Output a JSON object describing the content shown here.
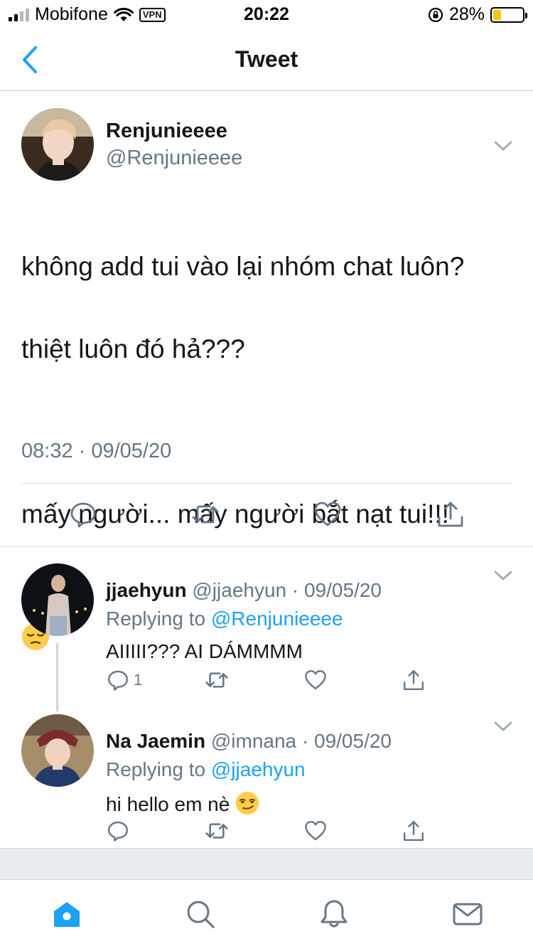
{
  "status_bar": {
    "carrier": "Mobifone",
    "vpn": "VPN",
    "time": "20:22",
    "battery": "28%",
    "battery_level": 0.28
  },
  "nav": {
    "title": "Tweet"
  },
  "tweet": {
    "author_name": "Renjunieeee",
    "author_handle": "@Renjunieeee",
    "line1": "không add tui vào lại nhóm chat luôn?",
    "line2": "thiệt luôn đó hả???",
    "line3": "mấy người... mấy người bắt nạt tui!!!",
    "timestamp": "08:32 · 09/05/20",
    "emoji": "pensive-face"
  },
  "replies": [
    {
      "name": "jjaehyun",
      "handle": "@jjaehyun",
      "date": "· 09/05/20",
      "replying_prefix": "Replying to",
      "replying_to": "@Renjunieeee",
      "text": "AIIIII??? AI DÁMMMM",
      "reply_count": "1"
    },
    {
      "name": "Na Jaemin",
      "handle": "@imnana",
      "date": "· 09/05/20",
      "replying_prefix": "Replying to",
      "replying_to": "@jjaehyun",
      "text": "hi hello em nè",
      "emoji": "smirking-face"
    }
  ],
  "colors": {
    "accent": "#1da1f2",
    "secondary_text": "#657786",
    "icon_gray": "#657786",
    "battery_fill": "#f5c60f"
  }
}
